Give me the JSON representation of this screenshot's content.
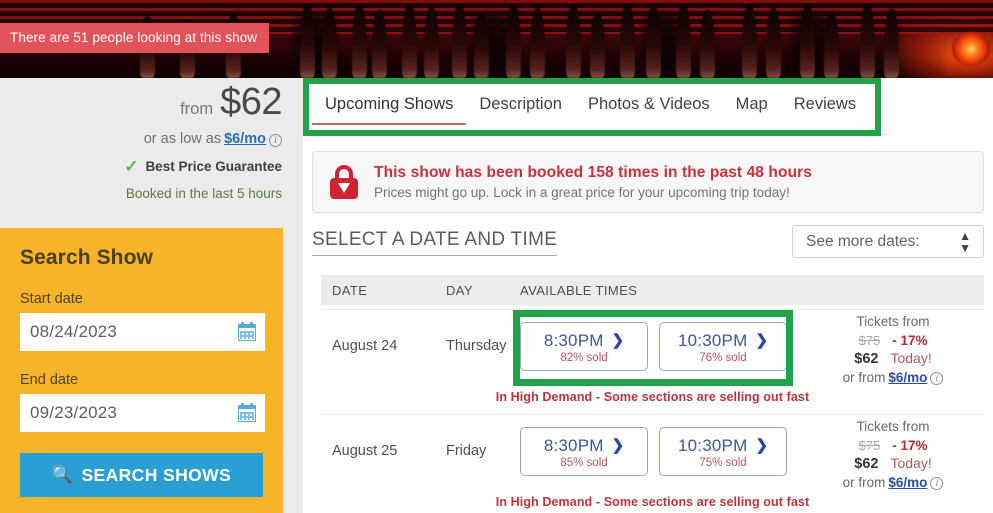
{
  "hero": {
    "viewers_badge": "There are 51 people looking at this show",
    "badge_color": "#e0535b"
  },
  "price_block": {
    "from_label": "from",
    "amount": "$62",
    "monthly_prefix": "or as low as",
    "monthly_link": "$6/mo",
    "guarantee": "Best Price Guarantee",
    "booked_recent": "Booked in the last 5 hours"
  },
  "search_panel": {
    "title": "Search Show",
    "start_label": "Start date",
    "start_value": "08/24/2023",
    "end_label": "End date",
    "end_value": "09/23/2023",
    "button_label": "SEARCH SHOWS",
    "panel_color": "#f5b429",
    "button_color": "#2a9fd6"
  },
  "tabs": [
    {
      "label": "Upcoming Shows",
      "active": true
    },
    {
      "label": "Description",
      "active": false
    },
    {
      "label": "Photos & Videos",
      "active": false
    },
    {
      "label": "Map",
      "active": false
    },
    {
      "label": "Reviews",
      "active": false
    }
  ],
  "alert": {
    "title": "This show has been booked 158 times in the past 48 hours",
    "subtitle": "Prices might go up. Lock in a great price for your upcoming trip today!",
    "icon": "lock-down-arrow-icon",
    "accent_color": "#c8313d"
  },
  "select_section": {
    "heading": "SELECT A DATE AND TIME",
    "dropdown_label": "See more dates:"
  },
  "table": {
    "headers": [
      "DATE",
      "DAY",
      "AVAILABLE TIMES"
    ],
    "rows": [
      {
        "date": "August 24",
        "day": "Thursday",
        "times": [
          {
            "time": "8:30PM",
            "sold": "82% sold"
          },
          {
            "time": "10:30PM",
            "sold": "76% sold"
          }
        ],
        "price": {
          "title": "Tickets from",
          "old": "$75",
          "discount": "- 17%",
          "new": "$62",
          "today": "Today!",
          "financing_prefix": "or from",
          "financing_link": "$6/mo"
        },
        "demand_note": "In High Demand - Some sections are selling out fast"
      },
      {
        "date": "August 25",
        "day": "Friday",
        "times": [
          {
            "time": "8:30PM",
            "sold": "85% sold"
          },
          {
            "time": "10:30PM",
            "sold": "75% sold"
          }
        ],
        "price": {
          "title": "Tickets from",
          "old": "$75",
          "discount": "- 17%",
          "new": "$62",
          "today": "Today!",
          "financing_prefix": "or from",
          "financing_link": "$6/mo"
        },
        "demand_note": "In High Demand - Some sections are selling out fast"
      }
    ]
  },
  "highlights": {
    "color": "#22a04a",
    "regions": [
      "tabs-navigation",
      "august-24-available-times"
    ]
  }
}
